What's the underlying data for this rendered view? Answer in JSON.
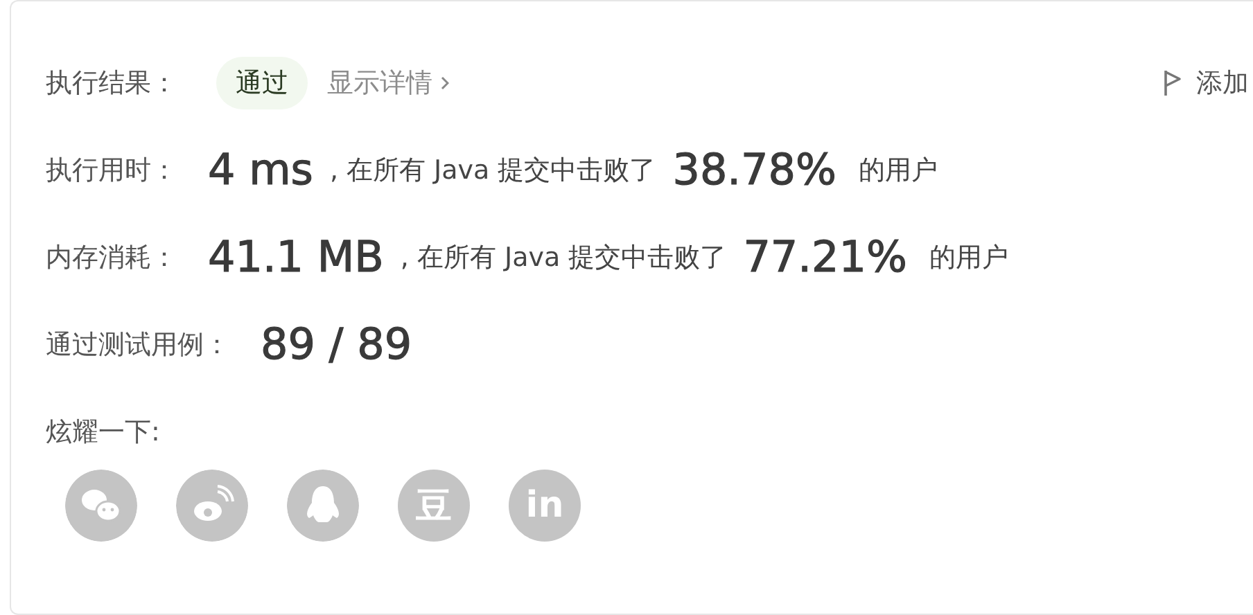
{
  "result": {
    "label": "执行结果：",
    "status": "通过",
    "details_link": "显示详情",
    "note_link": "添加"
  },
  "stats": [
    {
      "label": "执行用时：",
      "value": "4 ms",
      "text": ", 在所有 Java 提交中击败了",
      "percent": "38.78%",
      "suffix": "的用户"
    },
    {
      "label": "内存消耗：",
      "value": "41.1 MB",
      "text": ", 在所有 Java 提交中击败了",
      "percent": "77.21%",
      "suffix": "的用户"
    }
  ],
  "tests": {
    "label": "通过测试用例：",
    "value": "89 / 89"
  },
  "share": {
    "label": "炫耀一下:",
    "buttons": [
      {
        "kind": "chat"
      },
      {
        "kind": "swirl"
      },
      {
        "kind": "penguin"
      },
      {
        "kind": "glyph",
        "glyph": "豆"
      },
      {
        "kind": "glyph",
        "glyph": "in"
      }
    ]
  }
}
